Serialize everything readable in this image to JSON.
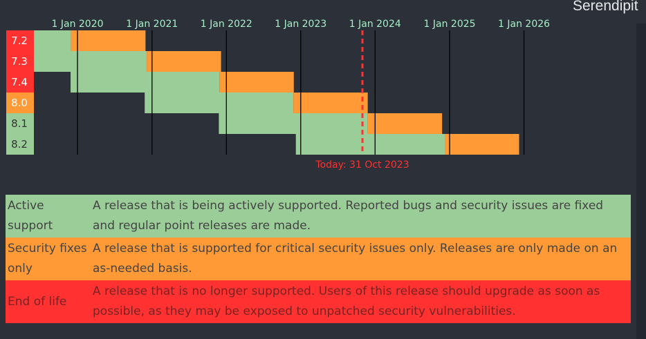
{
  "header": {
    "brand_text": "Serendipit"
  },
  "chart_data": {
    "type": "gantt",
    "x_axis_type": "date",
    "x_ticks": [
      "1 Jan 2020",
      "1 Jan 2021",
      "1 Jan 2022",
      "1 Jan 2023",
      "1 Jan 2024",
      "1 Jan 2025",
      "1 Jan 2026"
    ],
    "xlim": [
      "2019-06-01",
      "2026-08-01"
    ],
    "today": {
      "date": "2023-10-31",
      "label": "Today: 31 Oct 2023"
    },
    "colors": {
      "active": "#9acd98",
      "security": "#ff9a36",
      "eol": "#ff3131",
      "today": "#ff3131",
      "tick_text": "#a8f0c8",
      "grid": "#000000"
    },
    "branches": [
      {
        "version": "7.2",
        "status": "eol",
        "release": "2017-11-30",
        "active_end": "2019-11-30",
        "security_end": "2020-11-30"
      },
      {
        "version": "7.3",
        "status": "eol",
        "release": "2018-12-06",
        "active_end": "2020-12-06",
        "security_end": "2021-12-06"
      },
      {
        "version": "7.4",
        "status": "eol",
        "release": "2019-11-28",
        "active_end": "2021-11-28",
        "security_end": "2022-11-28"
      },
      {
        "version": "8.0",
        "status": "security",
        "release": "2020-11-26",
        "active_end": "2022-11-26",
        "security_end": "2023-11-26"
      },
      {
        "version": "8.1",
        "status": "active",
        "release": "2021-11-25",
        "active_end": "2023-11-25",
        "security_end": "2024-11-25"
      },
      {
        "version": "8.2",
        "status": "active",
        "release": "2022-12-08",
        "active_end": "2024-12-08",
        "security_end": "2025-12-08"
      }
    ],
    "grid": true
  },
  "legend": [
    {
      "key": "active",
      "name": "Active support",
      "description": "A release that is being actively supported. Reported bugs and security issues are fixed and regular point releases are made."
    },
    {
      "key": "security",
      "name": "Security fixes only",
      "description": "A release that is supported for critical security issues only. Releases are only made on an as-needed basis."
    },
    {
      "key": "eol",
      "name": "End of life",
      "description": "A release that is no longer supported. Users of this release should upgrade as soon as possible, as they may be exposed to unpatched security vulnerabilities."
    }
  ]
}
